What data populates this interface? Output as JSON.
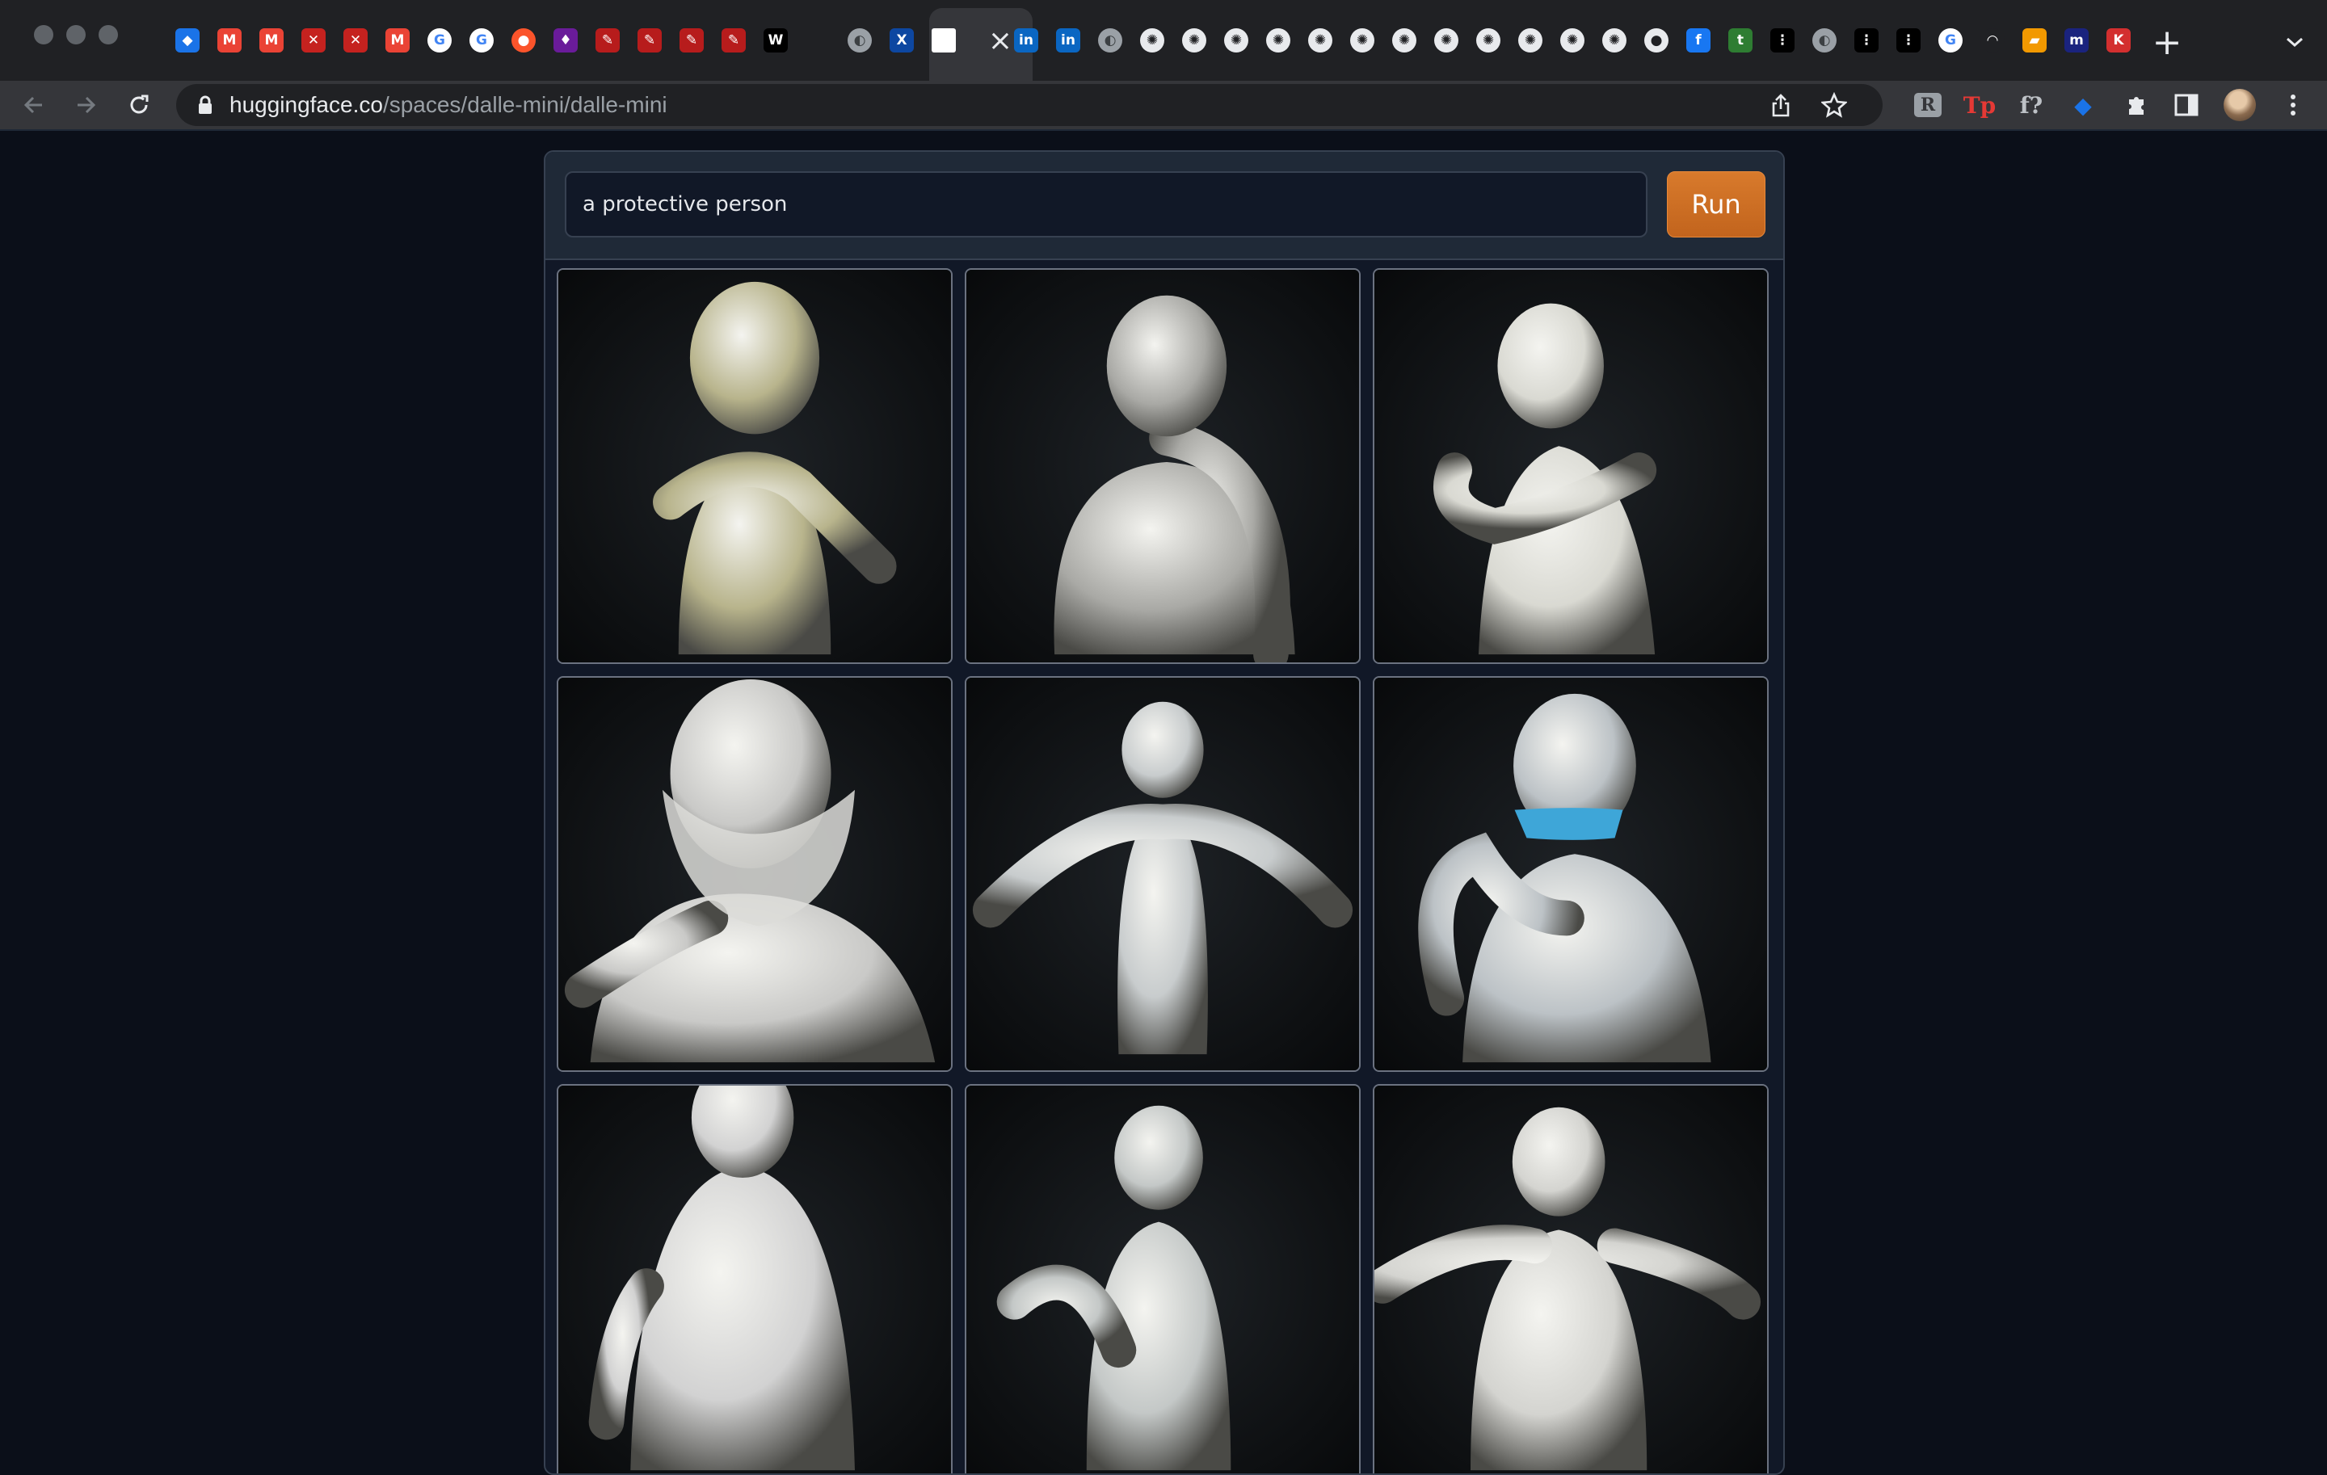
{
  "browser": {
    "url_host": "huggingface.co",
    "url_path": "/spaces/dalle-mini/dalle-mini",
    "tabs": [
      {
        "icon": "gem-icon",
        "glyph": "◆",
        "bg": "#1a73e8"
      },
      {
        "icon": "gmail-icon",
        "glyph": "M",
        "bg": "#ea4335"
      },
      {
        "icon": "gmail-icon",
        "glyph": "M",
        "bg": "#ea4335"
      },
      {
        "icon": "app-icon",
        "glyph": "✕",
        "bg": "#c5221f"
      },
      {
        "icon": "app-icon",
        "glyph": "✕",
        "bg": "#c5221f"
      },
      {
        "icon": "gmail-icon",
        "glyph": "M",
        "bg": "#ea4335"
      },
      {
        "icon": "google-icon",
        "glyph": "G",
        "bg": "#4285f4"
      },
      {
        "icon": "google-icon",
        "glyph": "G",
        "bg": "#4285f4"
      },
      {
        "icon": "brave-icon",
        "glyph": "●",
        "bg": "#fb542b"
      },
      {
        "icon": "app-icon",
        "glyph": "♦",
        "bg": "#6a1b9a"
      },
      {
        "icon": "pin-icon",
        "glyph": "✎",
        "bg": "#b71c1c"
      },
      {
        "icon": "pin-icon",
        "glyph": "✎",
        "bg": "#b71c1c"
      },
      {
        "icon": "pin-icon",
        "glyph": "✎",
        "bg": "#b71c1c"
      },
      {
        "icon": "pin-icon",
        "glyph": "✎",
        "bg": "#b71c1c"
      },
      {
        "icon": "wix-icon",
        "glyph": "W",
        "bg": "#000000"
      },
      {
        "icon": "blank-icon",
        "glyph": "",
        "bg": "#202124"
      },
      {
        "icon": "globe-icon",
        "glyph": "◐",
        "bg": "#5f6368"
      },
      {
        "icon": "xra-icon",
        "glyph": "X",
        "bg": "#0d47a1"
      },
      {
        "icon": "document-icon",
        "glyph": "",
        "bg": "#ffffff"
      },
      {
        "icon": "close-icon",
        "glyph": "",
        "bg": "#35363a"
      },
      {
        "icon": "linkedin-icon",
        "glyph": "in",
        "bg": "#0a66c2"
      },
      {
        "icon": "linkedin-icon",
        "glyph": "in",
        "bg": "#0a66c2"
      },
      {
        "icon": "globe-icon",
        "glyph": "◐",
        "bg": "#5f6368"
      },
      {
        "icon": "gear-icon",
        "glyph": "✺",
        "bg": "#202124"
      },
      {
        "icon": "gear-icon",
        "glyph": "✺",
        "bg": "#202124"
      },
      {
        "icon": "gear-icon",
        "glyph": "✺",
        "bg": "#202124"
      },
      {
        "icon": "gear-icon",
        "glyph": "✺",
        "bg": "#202124"
      },
      {
        "icon": "gear-icon",
        "glyph": "✺",
        "bg": "#202124"
      },
      {
        "icon": "gear-icon",
        "glyph": "✺",
        "bg": "#202124"
      },
      {
        "icon": "gear-icon",
        "glyph": "✺",
        "bg": "#202124"
      },
      {
        "icon": "gear-icon",
        "glyph": "✺",
        "bg": "#202124"
      },
      {
        "icon": "gear-icon",
        "glyph": "✺",
        "bg": "#202124"
      },
      {
        "icon": "gear-icon",
        "glyph": "✺",
        "bg": "#202124"
      },
      {
        "icon": "gear-icon",
        "glyph": "✺",
        "bg": "#202124"
      },
      {
        "icon": "gear-icon",
        "glyph": "✺",
        "bg": "#202124"
      },
      {
        "icon": "github-icon",
        "glyph": "●",
        "bg": "#202124"
      },
      {
        "icon": "facebook-icon",
        "glyph": "f",
        "bg": "#1877f2"
      },
      {
        "icon": "app-icon",
        "glyph": "t",
        "bg": "#2e7d32"
      },
      {
        "icon": "dots-icon",
        "glyph": "⋮",
        "bg": "#000000"
      },
      {
        "icon": "globe-icon",
        "glyph": "◐",
        "bg": "#5f6368"
      },
      {
        "icon": "dots-icon",
        "glyph": "⋮",
        "bg": "#000000"
      },
      {
        "icon": "dots-icon",
        "glyph": "⋮",
        "bg": "#000000"
      },
      {
        "icon": "google-icon",
        "glyph": "G",
        "bg": "#4285f4"
      },
      {
        "icon": "arc-icon",
        "glyph": "◠",
        "bg": "#202124"
      },
      {
        "icon": "book-icon",
        "glyph": "▰",
        "bg": "#f29900"
      },
      {
        "icon": "app-icon",
        "glyph": "m",
        "bg": "#1a237e"
      },
      {
        "icon": "app-icon",
        "glyph": "K",
        "bg": "#d32f2f"
      }
    ],
    "extensions": [
      {
        "icon": "extension-r-icon",
        "glyph": "R",
        "color": "#9aa0a6"
      },
      {
        "icon": "extension-tp-icon",
        "glyph": "Tp",
        "color": "#e53935"
      },
      {
        "icon": "extension-f-icon",
        "glyph": "f?",
        "color": "#bdc1c6"
      },
      {
        "icon": "extension-gem-icon",
        "glyph": "◆",
        "color": "#1a73e8"
      }
    ]
  },
  "app": {
    "prompt_value": "a protective person",
    "run_label": "Run",
    "images": [
      {
        "alt": "figure hugging itself",
        "tint": "#b8b48c"
      },
      {
        "alt": "figure with hand on shoulder",
        "tint": "#a9a9a5"
      },
      {
        "alt": "figure pointing",
        "tint": "#d9d9d2"
      },
      {
        "alt": "figure wearing face mask",
        "tint": "#c9c9c7"
      },
      {
        "alt": "figure with arms spread",
        "tint": "#c8cccd"
      },
      {
        "alt": "figure with blue mask",
        "tint": "#bcc2c6"
      },
      {
        "alt": "figure from behind",
        "tint": "#d2d2d2"
      },
      {
        "alt": "figure with hand on hip",
        "tint": "#c4c8c7"
      },
      {
        "alt": "figure gesturing",
        "tint": "#d4d4d0"
      }
    ]
  }
}
